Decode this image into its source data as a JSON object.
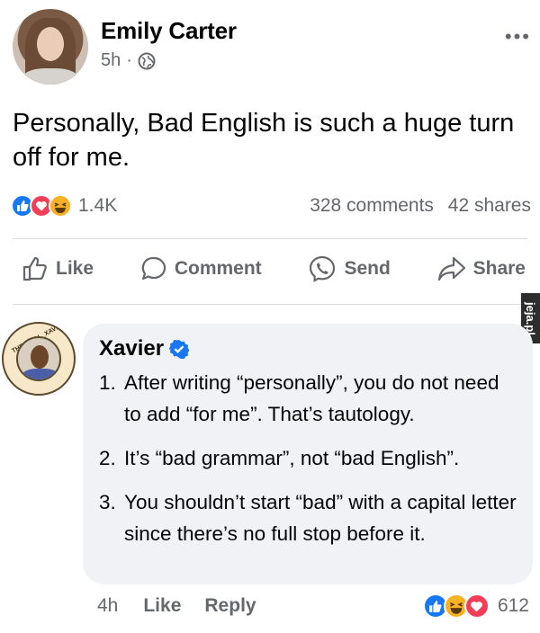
{
  "post": {
    "author": "Emily Carter",
    "age": "5h",
    "separator": "·",
    "visibility_icon": "globe-icon",
    "more_icon": "more-icon",
    "text": "Personally, Bad English is such a huge turn off for me.",
    "reaction_icons": [
      "like-icon",
      "love-icon",
      "haha-icon"
    ],
    "reaction_count": "1.4K",
    "comments": "328 comments",
    "shares": "42 shares"
  },
  "actions": {
    "like": "Like",
    "comment": "Comment",
    "send": "Send",
    "share": "Share"
  },
  "watermark": "jeja.pl",
  "comment": {
    "author": "Xavier",
    "avatar_ring_text": "THE_REAL_XAVIERS_WORLD",
    "points": [
      {
        "num": "1.",
        "text": "After writing “personally”, you do not need to add “for me”. That’s tautology."
      },
      {
        "num": "2.",
        "text": "It’s “bad grammar”, not “bad English”."
      },
      {
        "num": "3.",
        "text": "You shouldn’t start “bad” with a capital letter since there’s no full stop before it."
      }
    ],
    "age": "4h",
    "like": "Like",
    "reply": "Reply",
    "reaction_count": "612"
  },
  "colors": {
    "like_blue": "#1877f2",
    "love_red": "#f33e58",
    "haha_yellow": "#f7b125",
    "bubble": "#f0f2f5",
    "secondary_text": "#65676b"
  }
}
